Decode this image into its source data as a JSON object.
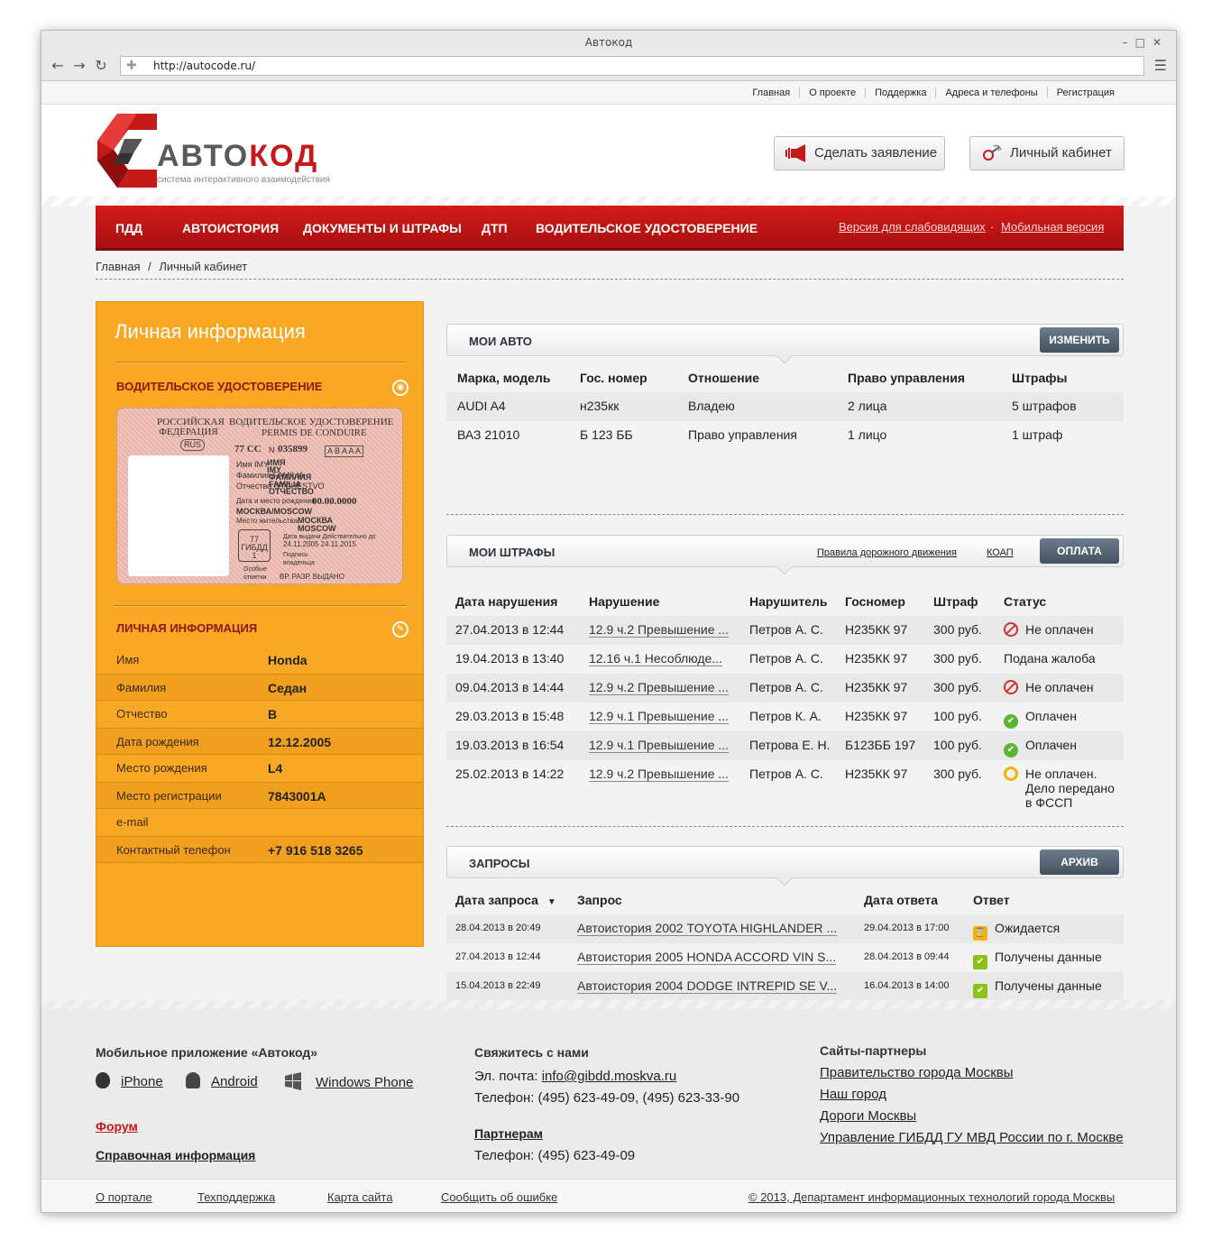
{
  "browser": {
    "window_title": "Автокод",
    "url": "http://autocode.ru/"
  },
  "toplinks": [
    "Главная",
    "О проекте",
    "Поддержка",
    "Адреса и телефоны",
    "Регистрация"
  ],
  "header": {
    "logo_left": "АВТО",
    "logo_right": "КОД",
    "logo_sub": "система интерактивного взаимодействия",
    "btn_claim": "Сделать заявление",
    "btn_cabinet": "Личный кабинет"
  },
  "nav": {
    "items": [
      "ПДД",
      "АВТОИСТОРИЯ",
      "ДОКУМЕНТЫ И ШТРАФЫ",
      "ДТП",
      "ВОДИТЕЛЬСКОЕ УДОСТОВЕРЕНИЕ"
    ],
    "alt_low_vision": "Версия для слабовидящих",
    "alt_dot": "·",
    "alt_mobile": "Мобильная версия"
  },
  "breadcrumbs": [
    "Главная",
    "/",
    "Личный кабинет"
  ],
  "left": {
    "title": "Личная информация",
    "license_heading": "ВОДИТЕЛЬСКОЕ УДОСТОВЕРЕНИЕ",
    "license": {
      "country": "РОССИЙСКАЯ ФЕДЕРАЦИЯ",
      "title_ru": "ВОДИТЕЛЬСКОЕ УДОСТОВЕРЕНИЕ",
      "title_fr": "PERMIS DE CONDUIRE",
      "rus": "RUS",
      "series": "77 СС",
      "n_label": "N",
      "number": "035899",
      "categories": "A B A A A",
      "field_lines": [
        "Имя IMY",
        "Фамилия FAMILIA",
        "Отчество OTCHESTVO"
      ],
      "field_values": [
        "ИМЯ",
        "IMY",
        "ФАМИЛИЯ",
        "FAMILIA",
        "ОТЧЕСТВО"
      ],
      "birth_label": "Дата и место рождения",
      "birth_date": "00.00.0000",
      "birth_place": "МОСКВА/MOSCOW",
      "residence_label": "Место жительства",
      "residence_value": "МОСКВА MOSCOW",
      "stamp": "77 ГИБДД 1",
      "issue_label": "Дата выдачи Действительно до",
      "issue_dates": "24.11.2005    24.11.2015",
      "sign_label": "Подпись владельца",
      "special_label": "Особые отметки",
      "special_value": "ВР. РАЗР. ВЫДАНО"
    },
    "personal_heading": "ЛИЧНАЯ ИНФОРМАЦИЯ",
    "rows": [
      {
        "k": "Имя",
        "v": "Honda"
      },
      {
        "k": "Фамилия",
        "v": "Седан"
      },
      {
        "k": "Отчество",
        "v": "В"
      },
      {
        "k": "Дата рождения",
        "v": "12.12.2005"
      },
      {
        "k": "Место рождения",
        "v": "L4"
      },
      {
        "k": "Место регистрации",
        "v": "7843001A"
      },
      {
        "k": "e-mail",
        "v": ""
      },
      {
        "k": "Контактный телефон",
        "v": "+7 916 518 3265"
      }
    ]
  },
  "cars": {
    "title": "МОИ АВТО",
    "button": "ИЗМЕНИТЬ",
    "headers": [
      "Марка, модель",
      "Гос. номер",
      "Отношение",
      "Право управления",
      "Штрафы"
    ],
    "rows": [
      [
        "AUDI A4",
        "н235кк",
        "Владею",
        "2 лица",
        "5 штрафов"
      ],
      [
        "ВАЗ 21010",
        "Б 123 ББ",
        "Право управления",
        "1 лицо",
        "1 штраф"
      ]
    ]
  },
  "fines": {
    "title": "МОИ ШТРАФЫ",
    "link_pdd": "Правила дорожного движения",
    "link_koap": "КОАП",
    "button": "ОПЛАТА",
    "headers": [
      "Дата нарушения",
      "Нарушение",
      "Нарушитель",
      "Госномер",
      "Штраф",
      "Статус"
    ],
    "rows": [
      {
        "date": "27.04.2013 в 12:44",
        "viol": "12.9 ч.2 Превышение ...",
        "who": "Петров А. С.",
        "plate": "Н235КК 97",
        "sum": "300 руб.",
        "status": "Не оплачен",
        "kind": "red"
      },
      {
        "date": "19.04.2013 в 13:40",
        "viol": "12.16 ч.1 Несоблюде...",
        "who": "Петров А. С.",
        "plate": "Н235КК 97",
        "sum": "300 руб.",
        "status": "Подана жалоба",
        "kind": "none"
      },
      {
        "date": "09.04.2013 в 14:44",
        "viol": "12.9 ч.2 Превышение ...",
        "who": "Петров А. С.",
        "plate": "Н235КК 97",
        "sum": "300 руб.",
        "status": "Не оплачен",
        "kind": "red"
      },
      {
        "date": "29.03.2013 в 15:48",
        "viol": "12.9 ч.1 Превышение ...",
        "who": "Петров К. А.",
        "plate": "Н235КК 97",
        "sum": "100 руб.",
        "status": "Оплачен",
        "kind": "green"
      },
      {
        "date": "19.03.2013 в 16:54",
        "viol": "12.9 ч.1 Превышение ...",
        "who": "Петрова Е. Н.",
        "plate": "Б123ББ 197",
        "sum": "100 руб.",
        "status": "Оплачен",
        "kind": "green"
      },
      {
        "date": "25.02.2013 в 14:22",
        "viol": "12.9 ч.2 Превышение ...",
        "who": "Петров А. С.",
        "plate": "Н235КК 97",
        "sum": "300 руб.",
        "status": "Не оплачен.",
        "status2": "Дело передано",
        "status3": "в ФССП",
        "kind": "yellow"
      }
    ]
  },
  "requests": {
    "title": "ЗАПРОСЫ",
    "button": "АРХИВ",
    "headers": [
      "Дата запроса",
      "Запрос",
      "Дата ответа",
      "Ответ"
    ],
    "rows": [
      {
        "date": "28.04.2013 в 20:49",
        "req": "Автоистория 2002 TOYOTA HIGHLANDER ...",
        "ans_date": "29.04.2013 в 17:00",
        "ans": "Ожидается",
        "kind": "wait"
      },
      {
        "date": "27.04.2013 в 12:44",
        "req": "Автоистория 2005 HONDA ACCORD VIN S...",
        "ans_date": "28.04.2013 в 09:44",
        "ans": "Получены данные",
        "kind": "ok"
      },
      {
        "date": "15.04.2013 в 22:49",
        "req": "Автоистория 2004 DODGE INTREPID SE V...",
        "ans_date": "16.04.2013 в 14:00",
        "ans": "Получены данные",
        "kind": "ok"
      }
    ]
  },
  "footer": {
    "app_title": "Мобильное приложение «Автокод»",
    "app_iphone": "iPhone",
    "app_android": "Android",
    "app_wp": "Windows Phone",
    "forum": "Форум",
    "reference": "Справочная информация",
    "contact_title": "Свяжитесь с нами",
    "email_label": "Эл. почта:",
    "email": "info@gibdd.moskva.ru",
    "phone_line": "Телефон: (495) 623-49-09, (495) 623-33-90",
    "partners_title": "Партнерам",
    "partners_phone": "Телефон: (495) 623-49-09",
    "sites_title": "Сайты-партнеры",
    "sites": [
      "Правительство города Москвы",
      "Наш город",
      "Дороги Москвы",
      "Управление ГИБДД ГУ МВД России по г. Москве"
    ],
    "bottom_links": [
      "О портале",
      "Техподдержка",
      "Карта сайта",
      "Сообщить об ошибке"
    ],
    "copyright": "© 2013, Департамент информационных технологий города Москвы"
  },
  "colors": {
    "nav_red": "#c51a1a",
    "panel_orange": "#f9a826",
    "button_slate": "#4e5c6a"
  }
}
